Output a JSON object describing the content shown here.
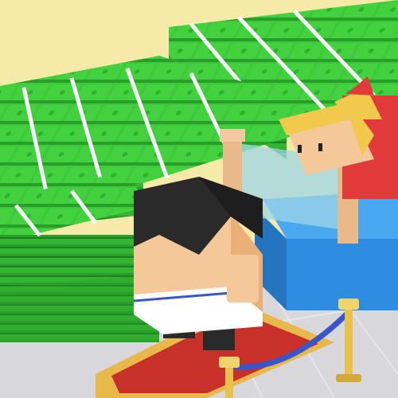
{
  "scene": {
    "description_kind": "3d-idle-bank-game",
    "colors": {
      "wall": "#f6eaa8",
      "floor": "#d8d8dc",
      "cash_top": "#3ec93a",
      "cash_side": "#2a9e2a",
      "cash_dark": "#1f7f22",
      "band": "#ffffff",
      "carpet": "#c8302a",
      "carpet_border": "#e8b84a",
      "counter": "#2e8de0",
      "counter_top": "#4aa8f0",
      "glass": "#9fd6ea",
      "wood": "#e9b98a",
      "brass": "#e8c24a",
      "rope": "#3a55c8",
      "player_hair": "#2a2a2a",
      "player_skin": "#f5c89a",
      "teller_hair": "#f2c94c",
      "teller_shirt": "#e23a3a"
    }
  }
}
